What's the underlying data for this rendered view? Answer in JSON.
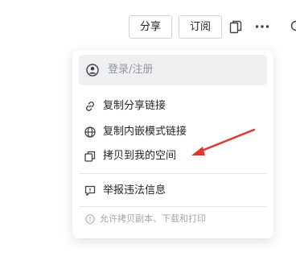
{
  "toolbar": {
    "share_label": "分享",
    "subscribe_label": "订阅"
  },
  "menu": {
    "login_label": "登录/注册",
    "items": [
      {
        "label": "复制分享链接",
        "icon": "link-icon"
      },
      {
        "label": "复制内嵌模式链接",
        "icon": "globe-icon"
      },
      {
        "label": "拷贝到我的空间",
        "icon": "copy-icon"
      },
      {
        "label": "举报违法信息",
        "icon": "report-icon"
      }
    ],
    "footer_note": "允许拷贝副本、下载和打印"
  },
  "colors": {
    "accent_arrow": "#e8322b",
    "text_primary": "#1f2329",
    "text_muted": "#8f959e",
    "hover_bg": "#eff0f1"
  }
}
